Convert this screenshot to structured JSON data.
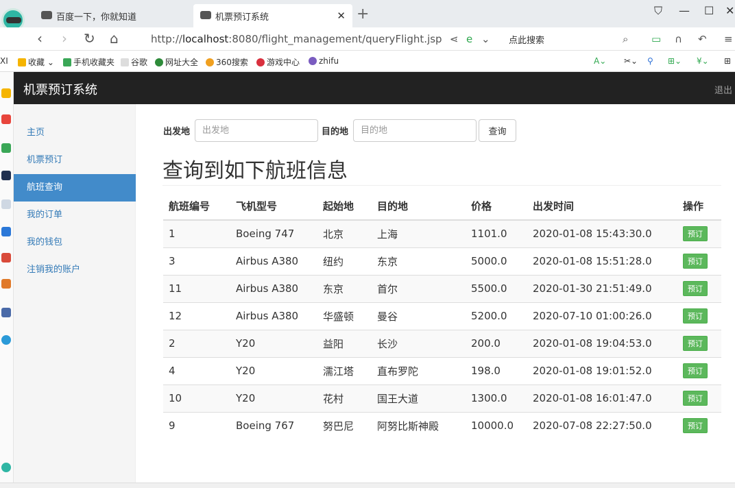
{
  "browser": {
    "tabs": [
      {
        "title": "百度一下，你就知道",
        "active": false
      },
      {
        "title": "机票预订系统",
        "active": true
      }
    ],
    "url_prefix": "http://",
    "url_host": "localhost",
    "url_rest": ":8080/flight_management/queryFlight.jsp",
    "search_hint": "点此搜索",
    "bookmarks": [
      "收藏",
      "手机收藏夹",
      "谷歌",
      "网址大全",
      "360搜索",
      "游戏中心",
      "zhifu"
    ]
  },
  "app": {
    "title": "机票预订系统",
    "logout": "退出"
  },
  "sidebar": {
    "items": [
      {
        "label": "主页",
        "active": false
      },
      {
        "label": "机票预订",
        "active": false
      },
      {
        "label": "航班查询",
        "active": true
      },
      {
        "label": "我的订单",
        "active": false
      },
      {
        "label": "我的钱包",
        "active": false
      },
      {
        "label": "注销我的账户",
        "active": false
      }
    ]
  },
  "search": {
    "from_label": "出发地",
    "from_placeholder": "出发地",
    "to_label": "目的地",
    "to_placeholder": "目的地",
    "button": "查询"
  },
  "results": {
    "heading": "查询到如下航班信息",
    "columns": [
      "航班编号",
      "飞机型号",
      "起始地",
      "目的地",
      "价格",
      "出发时间",
      "操作"
    ],
    "rows": [
      [
        "1",
        "Boeing 747",
        "北京",
        "上海",
        "1101.0",
        "2020-01-08 15:43:30.0",
        "预订"
      ],
      [
        "3",
        "Airbus A380",
        "纽约",
        "东京",
        "5000.0",
        "2020-01-08 15:51:28.0",
        "预订"
      ],
      [
        "11",
        "Airbus A380",
        "东京",
        "首尔",
        "5500.0",
        "2020-01-30 21:51:49.0",
        "预订"
      ],
      [
        "12",
        "Airbus A380",
        "华盛顿",
        "曼谷",
        "5200.0",
        "2020-07-10 01:00:26.0",
        "预订"
      ],
      [
        "2",
        "Y20",
        "益阳",
        "长沙",
        "200.0",
        "2020-01-08 19:04:53.0",
        "预订"
      ],
      [
        "4",
        "Y20",
        "濡江塔",
        "直布罗陀",
        "198.0",
        "2020-01-08 19:01:52.0",
        "预订"
      ],
      [
        "10",
        "Y20",
        "花村",
        "国王大道",
        "1300.0",
        "2020-01-08 16:01:47.0",
        "预订"
      ],
      [
        "9",
        "Boeing 767",
        "努巴尼",
        "阿努比斯神殿",
        "10000.0",
        "2020-07-08 22:27:50.0",
        "预订"
      ]
    ]
  }
}
